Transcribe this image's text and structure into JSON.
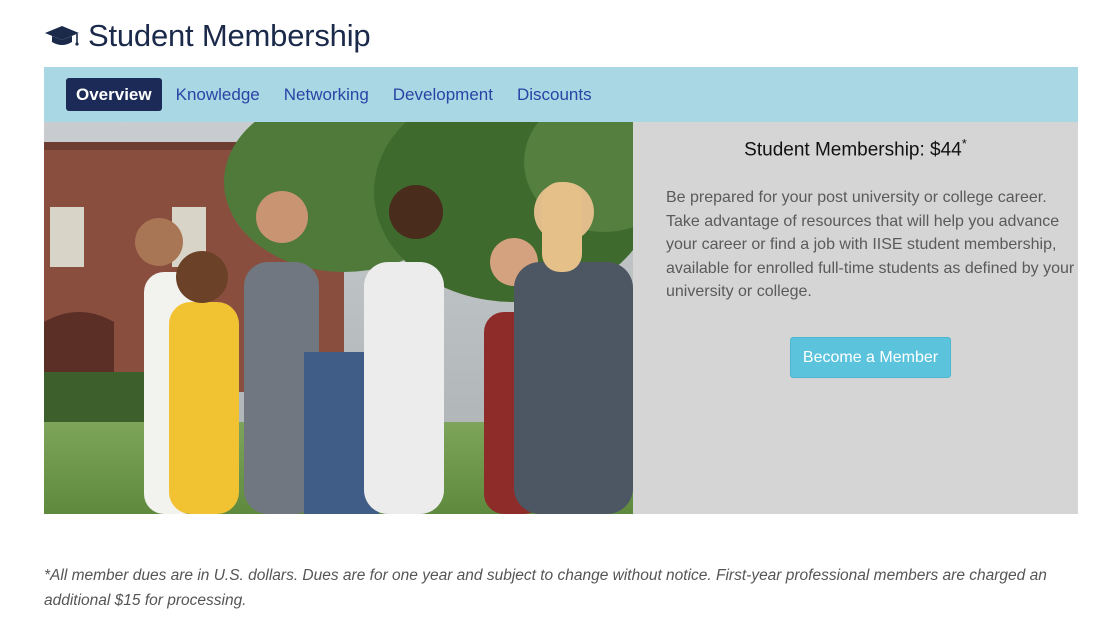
{
  "header": {
    "icon": "graduation-cap-icon",
    "title": "Student Membership"
  },
  "tabs": [
    {
      "label": "Overview",
      "active": true
    },
    {
      "label": "Knowledge",
      "active": false
    },
    {
      "label": "Networking",
      "active": false
    },
    {
      "label": "Development",
      "active": false
    },
    {
      "label": "Discounts",
      "active": false
    }
  ],
  "hero": {
    "image_alt": "students-walking-photo",
    "price_title": "Student Membership: $44",
    "price_marker": "*",
    "description": "Be prepared for your post university or college career. Take advantage of resources that will help you advance your career or find a job with IISE student membership, available for enrolled full-time students as defined by your university or college.",
    "cta_label": "Become a Member"
  },
  "footer": {
    "disclaimer": "*All member dues are in U.S. dollars. Dues are for one year and subject to change without notice. First-year professional members are charged an additional $15 for processing."
  },
  "colors": {
    "title": "#1b2a4a",
    "tabbar": "#a9d7e3",
    "tab_active_bg": "#1b2a56",
    "tab_link": "#2a44a6",
    "panel": "#d5d5d5",
    "cta": "#5bc4dc"
  }
}
